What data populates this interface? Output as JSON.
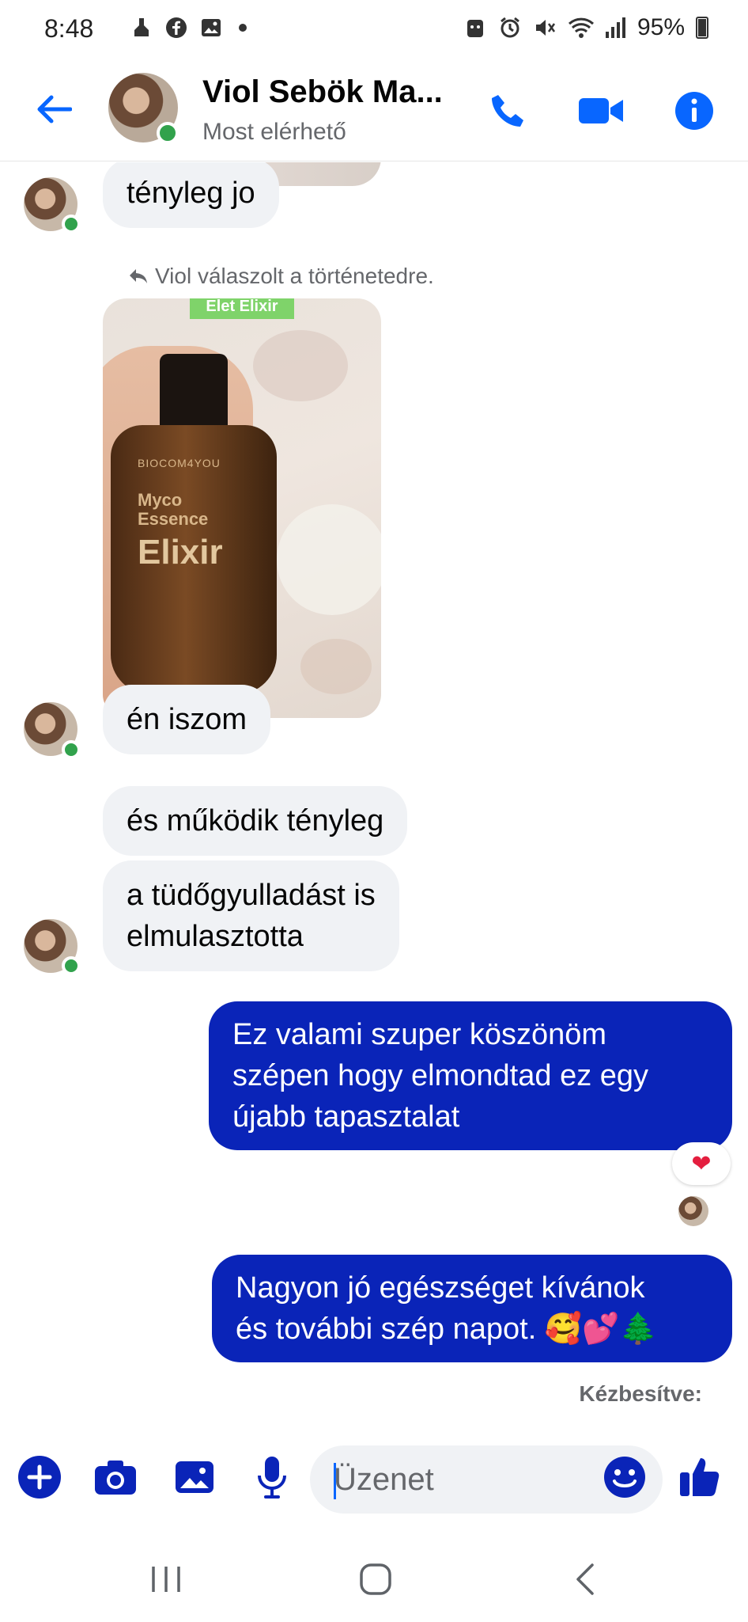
{
  "status_bar": {
    "time": "8:48",
    "battery": "95%"
  },
  "header": {
    "contact_name": "Viol Sebök Ma...",
    "contact_status": "Most elérhető",
    "accent_color": "#0866ff"
  },
  "conversation": {
    "reply_note": "Viol válaszolt a történetedre.",
    "story_label": "Elet Elixir",
    "product": {
      "brand": "BIOCOM4YOU",
      "line1": "Myco",
      "line2": "Essence",
      "line3": "Elixir"
    },
    "messages": [
      {
        "from": "contact",
        "text": "tényleg jo"
      },
      {
        "from": "contact",
        "text": "én iszom"
      },
      {
        "from": "contact",
        "text": "és működik tényleg"
      },
      {
        "from": "contact",
        "lines": [
          "a tüdőgyulladást is",
          "elmulasztotta"
        ]
      },
      {
        "from": "me",
        "lines": [
          "Ez valami szuper köszönöm",
          "szépen hogy elmondtad ez egy",
          "újabb tapasztalat"
        ],
        "reaction": "❤"
      },
      {
        "from": "me",
        "lines": [
          "Nagyon jó egészséget kívánok",
          "és további szép napot. 🥰💕🌲"
        ]
      }
    ],
    "delivery_status": "Kézbesítve:",
    "outgoing_color": "#0a24b8"
  },
  "composer": {
    "placeholder": "Üzenet"
  }
}
